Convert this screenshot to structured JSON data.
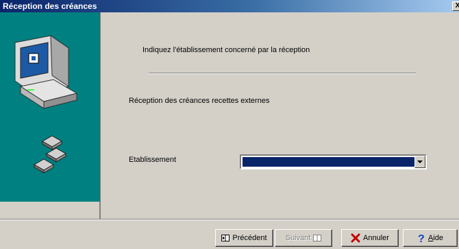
{
  "window": {
    "title": "Réception des créances",
    "close_label": "X"
  },
  "wizard": {
    "header": "Indiquez l'établissement concerné par la réception",
    "subheading": "Réception des créances recettes externes",
    "field_label": "Etablissement",
    "select_value": ""
  },
  "buttons": {
    "previous": "Précédent",
    "next": "Suivant",
    "cancel": "Annuler",
    "help_accel": "A",
    "help_rest": "ide"
  },
  "colors": {
    "side_panel": "#008080",
    "titlebar": "#0a246a",
    "dialog": "#d4d0c8"
  },
  "icons": {
    "side": [
      "computer-icon",
      "diskette-icon"
    ],
    "previous": "previous-icon",
    "next": "next-icon",
    "cancel": "cancel-icon",
    "help": "help-icon"
  }
}
